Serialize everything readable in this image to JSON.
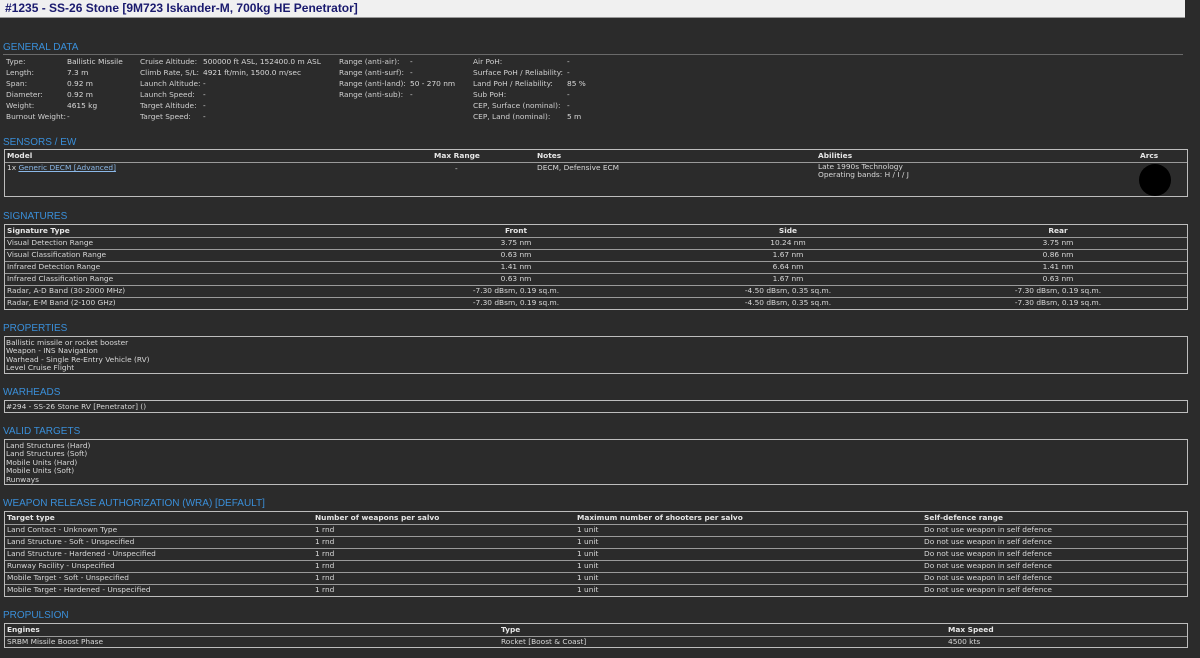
{
  "title": "#1235 - SS-26 Stone [9M723 Iskander-M, 700kg HE Penetrator]",
  "general": {
    "heading": "GENERAL DATA",
    "col1": [
      {
        "label": "Type:",
        "value": "Ballistic Missile"
      },
      {
        "label": "Length:",
        "value": "7.3 m"
      },
      {
        "label": "Span:",
        "value": "0.92 m"
      },
      {
        "label": "Diameter:",
        "value": "0.92 m"
      },
      {
        "label": "Weight:",
        "value": "4615 kg"
      },
      {
        "label": "Burnout Weight:",
        "value": "-"
      }
    ],
    "col2": [
      {
        "label": "Cruise Altitude:",
        "value": "500000 ft ASL, 152400.0 m ASL"
      },
      {
        "label": "Climb Rate, S/L:",
        "value": "4921 ft/min, 1500.0 m/sec"
      },
      {
        "label": "Launch Altitude:",
        "value": "-"
      },
      {
        "label": "Launch Speed:",
        "value": "-"
      },
      {
        "label": "Target Altitude:",
        "value": "-"
      },
      {
        "label": "Target Speed:",
        "value": "-"
      }
    ],
    "col3": [
      {
        "label": "Range (anti-air):",
        "value": "-"
      },
      {
        "label": "Range (anti-surf):",
        "value": "-"
      },
      {
        "label": "Range (anti-land):",
        "value": "50 - 270 nm"
      },
      {
        "label": "Range (anti-sub):",
        "value": "-"
      }
    ],
    "col4": [
      {
        "label": "Air PoH:",
        "value": "-"
      },
      {
        "label": "Surface PoH / Reliability:",
        "value": "-"
      },
      {
        "label": "Land PoH / Reliability:",
        "value": "85 %"
      },
      {
        "label": "Sub PoH:",
        "value": "-"
      },
      {
        "label": "CEP, Surface (nominal):",
        "value": "-"
      },
      {
        "label": "CEP, Land (nominal):",
        "value": "5 m"
      }
    ]
  },
  "sensors": {
    "heading": "SENSORS / EW",
    "headers": [
      "Model",
      "Max Range",
      "Notes",
      "Abilities",
      "Arcs"
    ],
    "row": {
      "count": "1x",
      "model": "Generic DECM [Advanced]",
      "max_range": "-",
      "notes": "DECM, Defensive ECM",
      "abilities": [
        "Late 1990s Technology",
        "Operating bands: H / I / J"
      ]
    }
  },
  "signatures": {
    "heading": "SIGNATURES",
    "headers": [
      "Signature Type",
      "Front",
      "Side",
      "Rear"
    ],
    "rows": [
      [
        "Visual Detection Range",
        "3.75 nm",
        "10.24 nm",
        "3.75 nm"
      ],
      [
        "Visual Classification Range",
        "0.63 nm",
        "1.67 nm",
        "0.86 nm"
      ],
      [
        "Infrared Detection Range",
        "1.41 nm",
        "6.64 nm",
        "1.41 nm"
      ],
      [
        "Infrared Classification Range",
        "0.63 nm",
        "1.67 nm",
        "0.63 nm"
      ],
      [
        "Radar, A-D Band (30-2000 MHz)",
        "-7.30 dBsm, 0.19 sq.m.",
        "-4.50 dBsm, 0.35 sq.m.",
        "-7.30 dBsm, 0.19 sq.m."
      ],
      [
        "Radar, E-M Band (2-100 GHz)",
        "-7.30 dBsm, 0.19 sq.m.",
        "-4.50 dBsm, 0.35 sq.m.",
        "-7.30 dBsm, 0.19 sq.m."
      ]
    ]
  },
  "properties": {
    "heading": "PROPERTIES",
    "items": [
      "Ballistic missile or rocket booster",
      "Weapon - INS Navigation",
      "Warhead - Single Re-Entry Vehicle (RV)",
      "Level Cruise Flight"
    ]
  },
  "warheads": {
    "heading": "WARHEADS",
    "items": [
      "#294 - SS-26 Stone RV [Penetrator] ()"
    ]
  },
  "valid_targets": {
    "heading": "VALID TARGETS",
    "items": [
      "Land Structures (Hard)",
      "Land Structures (Soft)",
      "Mobile Units (Hard)",
      "Mobile Units (Soft)",
      "Runways"
    ]
  },
  "wra": {
    "heading": "WEAPON RELEASE AUTHORIZATION (WRA) [DEFAULT]",
    "headers": [
      "Target type",
      "Number of weapons per salvo",
      "Maximum number of shooters per salvo",
      "Self-defence range"
    ],
    "rows": [
      [
        "Land Contact - Unknown Type",
        "1 rnd",
        "1 unit",
        "Do not use weapon in self defence"
      ],
      [
        "Land Structure - Soft - Unspecified",
        "1 rnd",
        "1 unit",
        "Do not use weapon in self defence"
      ],
      [
        "Land Structure - Hardened - Unspecified",
        "1 rnd",
        "1 unit",
        "Do not use weapon in self defence"
      ],
      [
        "Runway Facility - Unspecified",
        "1 rnd",
        "1 unit",
        "Do not use weapon in self defence"
      ],
      [
        "Mobile Target - Soft - Unspecified",
        "1 rnd",
        "1 unit",
        "Do not use weapon in self defence"
      ],
      [
        "Mobile Target - Hardened - Unspecified",
        "1 rnd",
        "1 unit",
        "Do not use weapon in self defence"
      ]
    ]
  },
  "propulsion": {
    "heading": "PROPULSION",
    "headers": [
      "Engines",
      "Type",
      "Max Speed"
    ],
    "rows": [
      [
        "SRBM Missile Boost Phase",
        "Rocket [Boost & Coast]",
        "4500 kts"
      ]
    ]
  }
}
